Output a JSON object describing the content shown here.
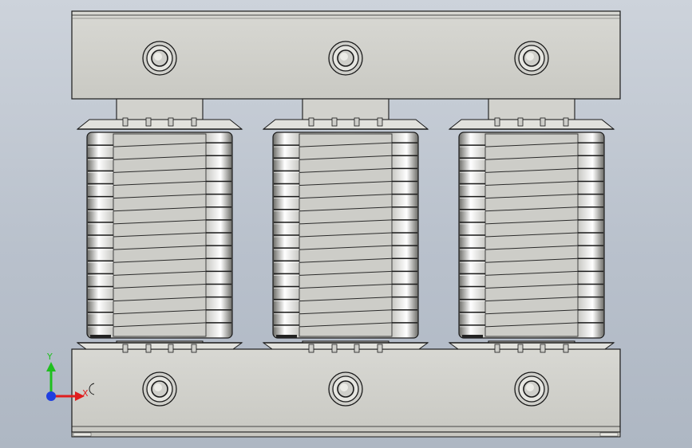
{
  "viewport": {
    "model": "three-phase-transformer",
    "legs": 3,
    "coil_turns_visible": 16,
    "colors": {
      "background_top": "#cdd3db",
      "background_bottom": "#aeb7c3",
      "model_fill": "#d4d4cf",
      "model_edge": "#1a1a1a",
      "coil_highlight": "#ffffff",
      "coil_shadow": "#5f5f5a"
    }
  },
  "triad": {
    "x_label": "X",
    "y_label": "Y",
    "x_color": "#e01e1e",
    "y_color": "#1fbf1f",
    "z_color": "#1f3fe0"
  }
}
